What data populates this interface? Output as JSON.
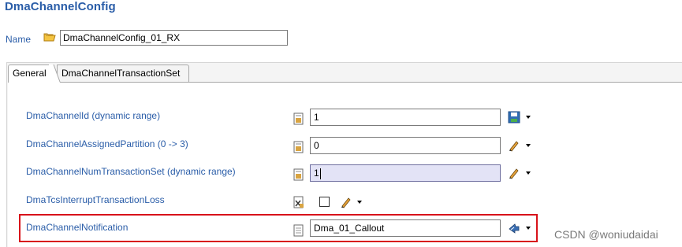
{
  "header": {
    "title": "DmaChannelConfig"
  },
  "name_row": {
    "label": "Name",
    "value": "DmaChannelConfig_01_RX"
  },
  "tabs": [
    {
      "label": "General",
      "active": true
    },
    {
      "label": "DmaChannelTransactionSet",
      "active": false
    }
  ],
  "properties": [
    {
      "label": "DmaChannelId (dynamic range)",
      "value": "1",
      "tool": "save-icon"
    },
    {
      "label": "DmaChannelAssignedPartition (0 -> 3)",
      "value": "0",
      "tool": "pencil-icon"
    },
    {
      "label": "DmaChannelNumTransactionSet (dynamic range)",
      "value": "1",
      "tool": "pencil-icon",
      "focused": true
    },
    {
      "label": "DmaTcsInterruptTransactionLoss",
      "checked": false,
      "tool": "pencil-icon"
    },
    {
      "label": "DmaChannelNotification",
      "value": "Dma_01_Callout",
      "tool": "reference-icon"
    }
  ],
  "watermark": "CSDN @woniudaidai",
  "colors": {
    "label_blue": "#2a5da8",
    "highlight_red": "#d8121a",
    "focused_field": "#e3e3f6"
  }
}
